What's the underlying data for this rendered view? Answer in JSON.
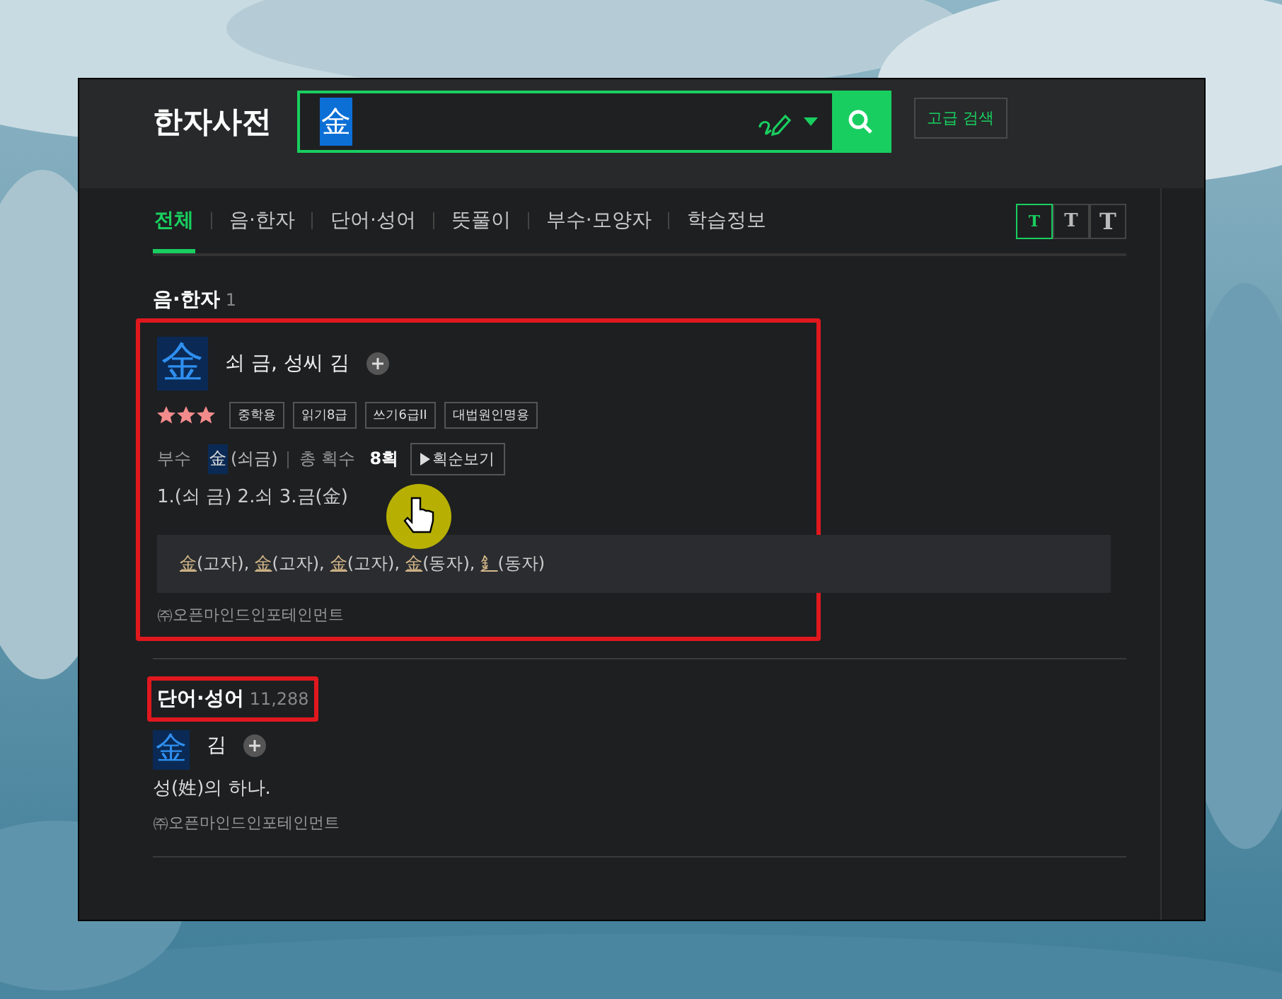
{
  "app": {
    "title": "한자사전"
  },
  "search": {
    "value": "金",
    "advanced_button": "고급 검색"
  },
  "tabs": [
    {
      "label": "전체",
      "selected": true
    },
    {
      "label": "음·한자",
      "selected": false
    },
    {
      "label": "단어·성어",
      "selected": false
    },
    {
      "label": "뜻풀이",
      "selected": false
    },
    {
      "label": "부수·모양자",
      "selected": false
    },
    {
      "label": "학습정보",
      "selected": false
    }
  ],
  "font_size_buttons": [
    {
      "label": "T",
      "selected": true
    },
    {
      "label": "T",
      "selected": false
    },
    {
      "label": "T",
      "selected": false
    }
  ],
  "sections": [
    {
      "kind": "hanja",
      "heading": "음·한자",
      "count": "1",
      "annotated": false,
      "entry": {
        "annotated": true,
        "char": "金",
        "meaning": "쇠 금, 성씨 김",
        "stars": 3,
        "tags": [
          "중학용",
          "읽기8급",
          "쓰기6급II",
          "대법원인명용"
        ],
        "radical_label": "부수",
        "radical_char": "金",
        "radical_reading": "(쇠금)",
        "strokes_label": "총 획수",
        "strokes": "8획",
        "stroke_button": "획순보기",
        "definition": "1.(쇠 금) 2.쇠 3.금(金)",
        "variants": [
          {
            "char": "金",
            "note": "(고자),"
          },
          {
            "char": "金",
            "note": "(고자),"
          },
          {
            "char": "金",
            "note": "(고자),"
          },
          {
            "char": "金",
            "note": "(동자),"
          },
          {
            "char": "釒",
            "note": "(동자)"
          }
        ],
        "source": "㈜오픈마인드인포테인먼트"
      }
    },
    {
      "kind": "word",
      "heading": "단어·성어",
      "count": "11,288",
      "annotated": true,
      "entry": {
        "annotated": false,
        "char": "金",
        "reading": "김",
        "definition": "성(姓)의 하나.",
        "source": "㈜오픈마인드인포테인먼트"
      }
    }
  ]
}
